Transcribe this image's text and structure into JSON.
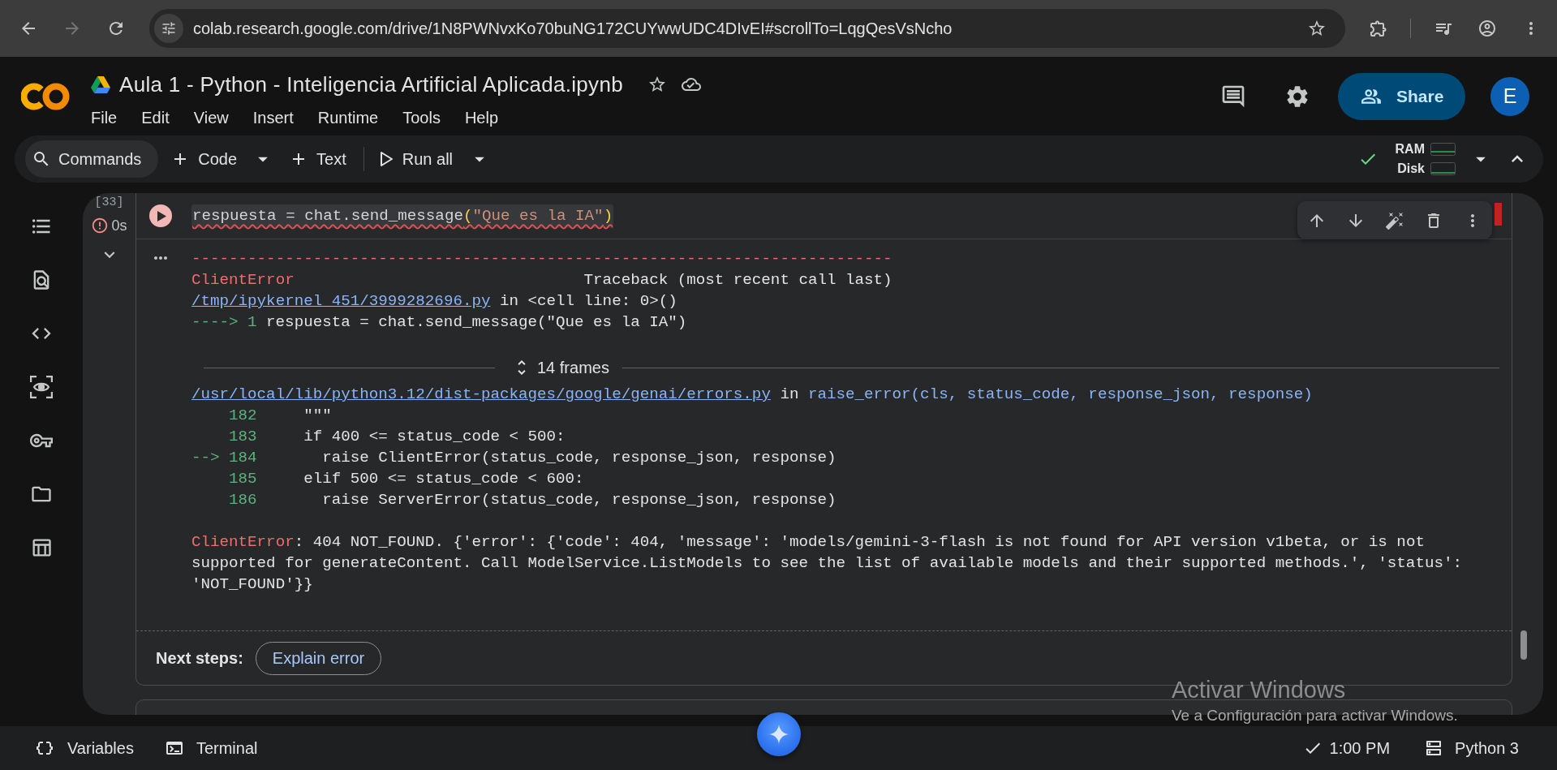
{
  "browser": {
    "url": "colab.research.google.com/drive/1N8PWNvxKo70buNG172CUYwwUDC4DIvEI#scrollTo=LqgQesVsNcho",
    "forward_disabled": true,
    "bookmarked": false
  },
  "header": {
    "title": "Aula 1 - Python - Inteligencia Artificial Aplicada.ipynb",
    "starred": false,
    "menu": [
      "File",
      "Edit",
      "View",
      "Insert",
      "Runtime",
      "Tools",
      "Help"
    ],
    "share": "Share",
    "avatar": "E"
  },
  "toolbar": {
    "commands": "Commands",
    "add_code": "Code",
    "add_text": "Text",
    "run_all": "Run all",
    "connected": true,
    "resources": [
      {
        "label": "RAM"
      },
      {
        "label": "Disk"
      }
    ]
  },
  "cell": {
    "execution_count": "[33]",
    "failed": true,
    "duration": "0s",
    "code": [
      {
        "kind": "plain",
        "text": "respuesta = chat.send_message"
      },
      {
        "kind": "bracket",
        "text": "("
      },
      {
        "kind": "string",
        "text": "\"Que es la IA\""
      },
      {
        "kind": "bracket",
        "text": ")"
      }
    ],
    "output": {
      "separator": "---------------------------------------------------------------------------",
      "exception": "ClientError",
      "heading": "Traceback (most recent call last)",
      "frames": [
        {
          "kind": "cell",
          "file": "/tmp/ipykernel_451/3999282696.py",
          "in": "in",
          "function": "<cell line: 0>()",
          "lines": [
            {
              "marker": "---->",
              "number": "1",
              "code": "respuesta = chat.send_message(\"Que es la IA\")"
            }
          ]
        },
        {
          "kind": "collapsed",
          "label": "14 frames",
          "expanded": false
        },
        {
          "kind": "module",
          "file": "/usr/local/lib/python3.12/dist-packages/google/genai/errors.py",
          "in": "in",
          "function": "raise_error(cls, status_code, response_json, response)",
          "lines": [
            {
              "number": "182",
              "code": "    \"\"\""
            },
            {
              "number": "183",
              "code": "    if 400 <= status_code < 500:"
            },
            {
              "marker": "-->",
              "number": "184",
              "code": "      raise ClientError(status_code, response_json, response)"
            },
            {
              "number": "185",
              "code": "    elif 500 <= status_code < 600:"
            },
            {
              "number": "186",
              "code": "      raise ServerError(status_code, response_json, response)"
            }
          ]
        }
      ],
      "error": {
        "exception": "ClientError",
        "message": ": 404 NOT_FOUND. {'error': {'code': 404, 'message': 'models/gemini-3-flash is not found for API version v1beta, or is not supported for generateContent. Call ModelService.ListModels to see the list of available models and their supported methods.', 'status': 'NOT_FOUND'}}"
      }
    },
    "next_steps": {
      "label": "Next steps:",
      "actions": [
        "Explain error"
      ]
    }
  },
  "status_bar": {
    "variables": "Variables",
    "terminal": "Terminal",
    "last_run": "1:00 PM",
    "runtime": "Python 3"
  },
  "windows_notice": {
    "title": "Activar Windows",
    "text": "Ve a Configuración para activar Windows."
  }
}
